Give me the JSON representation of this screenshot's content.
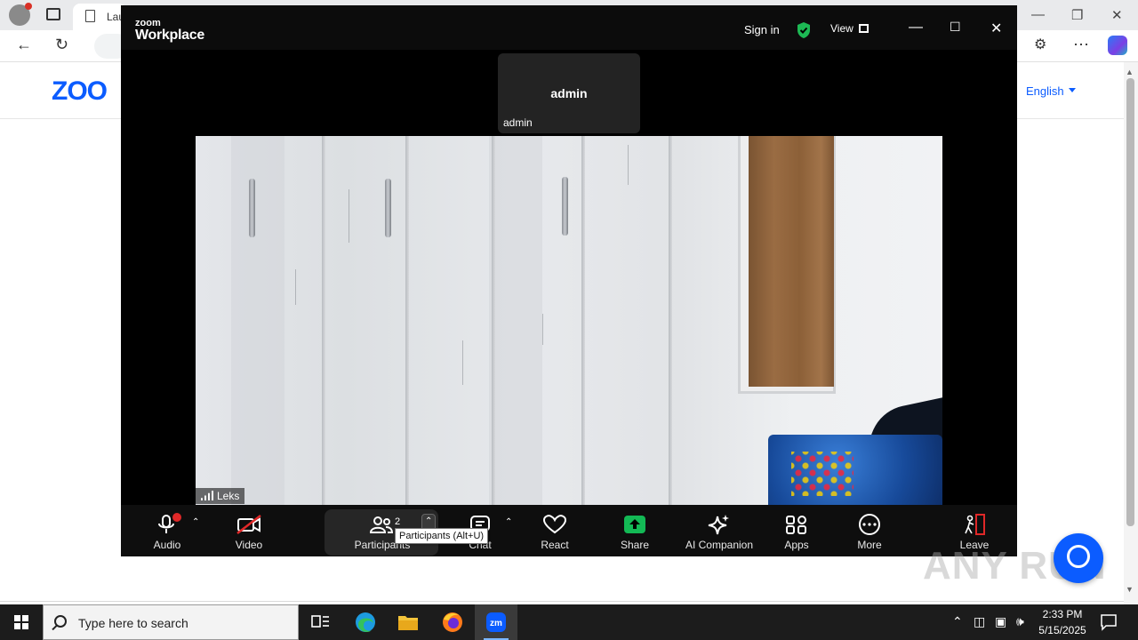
{
  "browser": {
    "tab_title": "Lau",
    "language_link": "English",
    "page_logo": "ZOO",
    "window_controls": [
      "minimize",
      "restore",
      "close"
    ]
  },
  "zoom": {
    "logo_small": "zoom",
    "logo_big": "Workplace",
    "sign_in": "Sign in",
    "view": "View",
    "shield_color": "#1db954",
    "host_tile": {
      "name_center": "admin",
      "name_label": "admin"
    },
    "video_name_tag": "Leks",
    "toolbar": {
      "audio": "Audio",
      "video": "Video",
      "participants": "Participants",
      "participants_count": "2",
      "participants_tooltip": "Participants (Alt+U)",
      "chat": "Chat",
      "react": "React",
      "share": "Share",
      "ai_companion": "AI Companion",
      "apps": "Apps",
      "more": "More",
      "leave": "Leave"
    },
    "colors": {
      "share_green": "#13b955",
      "leave_red": "#e02828",
      "mic_badge": "#e02828"
    }
  },
  "watermark": "ANY RUN",
  "taskbar": {
    "search_placeholder": "Type here to search",
    "apps": [
      "task-view",
      "edge",
      "file-explorer",
      "firefox",
      "zoom"
    ],
    "time": "2:33 PM",
    "date": "5/15/2025"
  }
}
